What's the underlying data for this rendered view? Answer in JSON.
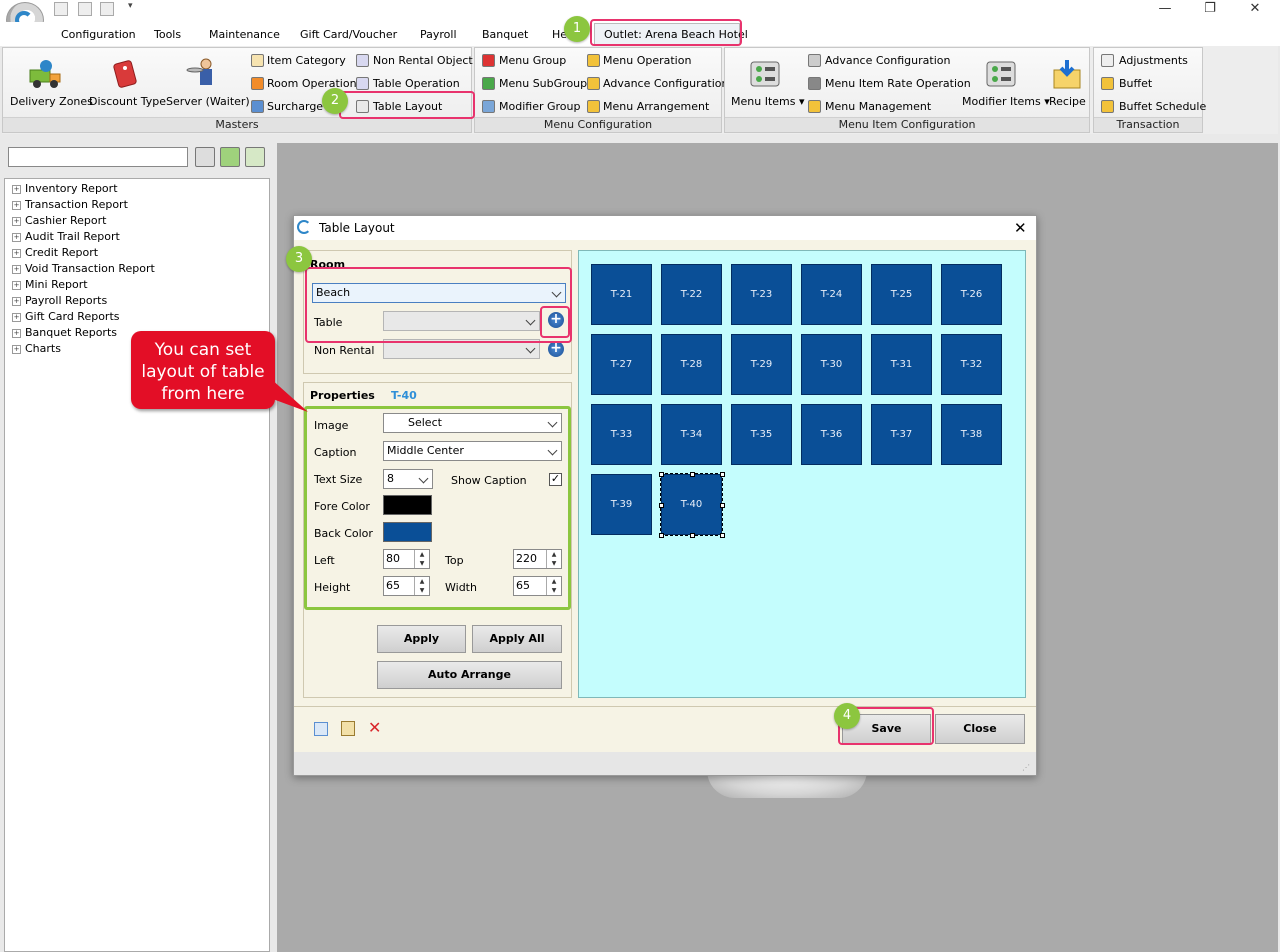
{
  "app": {
    "quick_access_icons": [
      "grid-icon",
      "edit-icon",
      "print-icon"
    ],
    "window_controls": [
      "—",
      "❐",
      "✕"
    ]
  },
  "menu": {
    "items": [
      "Configuration",
      "Tools",
      "Maintenance",
      "Gift Card/Voucher",
      "Payroll",
      "Banquet",
      "Help"
    ],
    "outlet_tab": "Outlet: Arena Beach Hotel"
  },
  "ribbon": {
    "masters": {
      "label": "Masters",
      "big": [
        "Delivery Zones",
        "Discount Type",
        "Server (Waiter)"
      ],
      "small_col1": [
        "Item Category",
        "Room Operation",
        "Surcharge"
      ],
      "small_col2": [
        "Non Rental Object",
        "Table Operation",
        "Table Layout"
      ]
    },
    "menu_config": {
      "label": "Menu Configuration",
      "col1": [
        "Menu Group",
        "Menu SubGroup",
        "Modifier Group"
      ],
      "col2": [
        "Menu Operation",
        "Advance Configuration",
        "Menu Arrangement"
      ]
    },
    "menu_item_config": {
      "label": "Menu Item Configuration",
      "menu_items": "Menu Items",
      "col": [
        "Advance Configuration",
        "Menu Item Rate Operation",
        "Menu Management"
      ],
      "modifier_items": "Modifier Items",
      "recipe": "Recipe"
    },
    "transaction": {
      "label": "Transaction",
      "items": [
        "Adjustments",
        "Buffet",
        "Buffet Schedule"
      ]
    }
  },
  "tree": {
    "search_value": "",
    "items": [
      "Inventory Report",
      "Transaction Report",
      "Cashier Report",
      "Audit Trail Report",
      "Credit Report",
      "Void Transaction Report",
      "Mini Report",
      "Payroll Reports",
      "Gift Card Reports",
      "Banquet Reports",
      "Charts"
    ]
  },
  "dialog": {
    "title": "Table Layout",
    "room_section": "Room",
    "room_value": "Beach",
    "table_label": "Table",
    "table_value": "",
    "nonrental_label": "Non Rental",
    "nonrental_value": "",
    "properties_label": "Properties",
    "properties_selected": "T-40",
    "image_label": "Image",
    "image_value": "Select",
    "caption_label": "Caption",
    "caption_value": "Middle Center",
    "textsize_label": "Text Size",
    "textsize_value": "8",
    "showcaption_label": "Show Caption",
    "showcaption_checked": true,
    "forecolor_label": "Fore Color",
    "forecolor": "#000000",
    "backcolor_label": "Back Color",
    "backcolor": "#0a4f97",
    "left_label": "Left",
    "left_value": "80",
    "top_label": "Top",
    "top_value": "220",
    "height_label": "Height",
    "height_value": "65",
    "width_label": "Width",
    "width_value": "65",
    "apply": "Apply",
    "apply_all": "Apply All",
    "auto_arrange": "Auto Arrange",
    "save": "Save",
    "close": "Close",
    "tables": [
      "T-21",
      "T-22",
      "T-23",
      "T-24",
      "T-25",
      "T-26",
      "T-27",
      "T-28",
      "T-29",
      "T-30",
      "T-31",
      "T-32",
      "T-33",
      "T-34",
      "T-35",
      "T-36",
      "T-37",
      "T-38",
      "T-39",
      "T-40"
    ]
  },
  "annotations": {
    "step1": "1",
    "step2": "2",
    "step3": "3",
    "step4": "4",
    "callout": "You can set layout of table from here"
  }
}
